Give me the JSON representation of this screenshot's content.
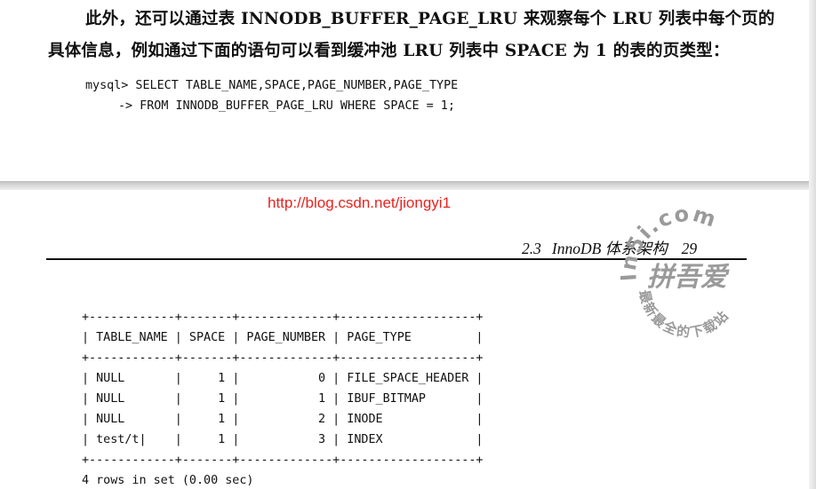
{
  "page_top": {
    "paragraph_line1": "此外，还可以通过表 INNODB_BUFFER_PAGE_LRU 来观察每个 LRU 列表中每个页的",
    "paragraph_line2": "具体信息，例如通过下面的语句可以看到缓冲池 LRU 列表中 SPACE 为 1 的表的页类型：",
    "code_line1": "mysql> SELECT TABLE_NAME,SPACE,PAGE_NUMBER,PAGE_TYPE",
    "code_line2": "-> FROM INNODB_BUFFER_PAGE_LRU WHERE SPACE = 1;"
  },
  "page_bottom": {
    "url": "http://blog.csdn.net/jiongyi1",
    "section_number": "2.3",
    "section_title": "InnoDB 体系架构",
    "page_number": "29",
    "table_border": "+------------+-------+-------------+-------------------+",
    "table_header": "| TABLE_NAME | SPACE | PAGE_NUMBER | PAGE_TYPE         |",
    "table_rows": [
      "| NULL       |     1 |           0 | FILE_SPACE_HEADER |",
      "| NULL       |     1 |           1 | IBUF_BITMAP       |",
      "| NULL       |     1 |           2 | INODE             |",
      "| test/t|    |     1 |           3 | INDEX             |"
    ],
    "result_summary": "4 rows in set (0.00 sec)"
  },
  "watermark": {
    "url_text": "ln5i.com",
    "center_text": "拼吾爱",
    "ring_text": "最新最全的下载站",
    "color": "#9a9a9a"
  }
}
